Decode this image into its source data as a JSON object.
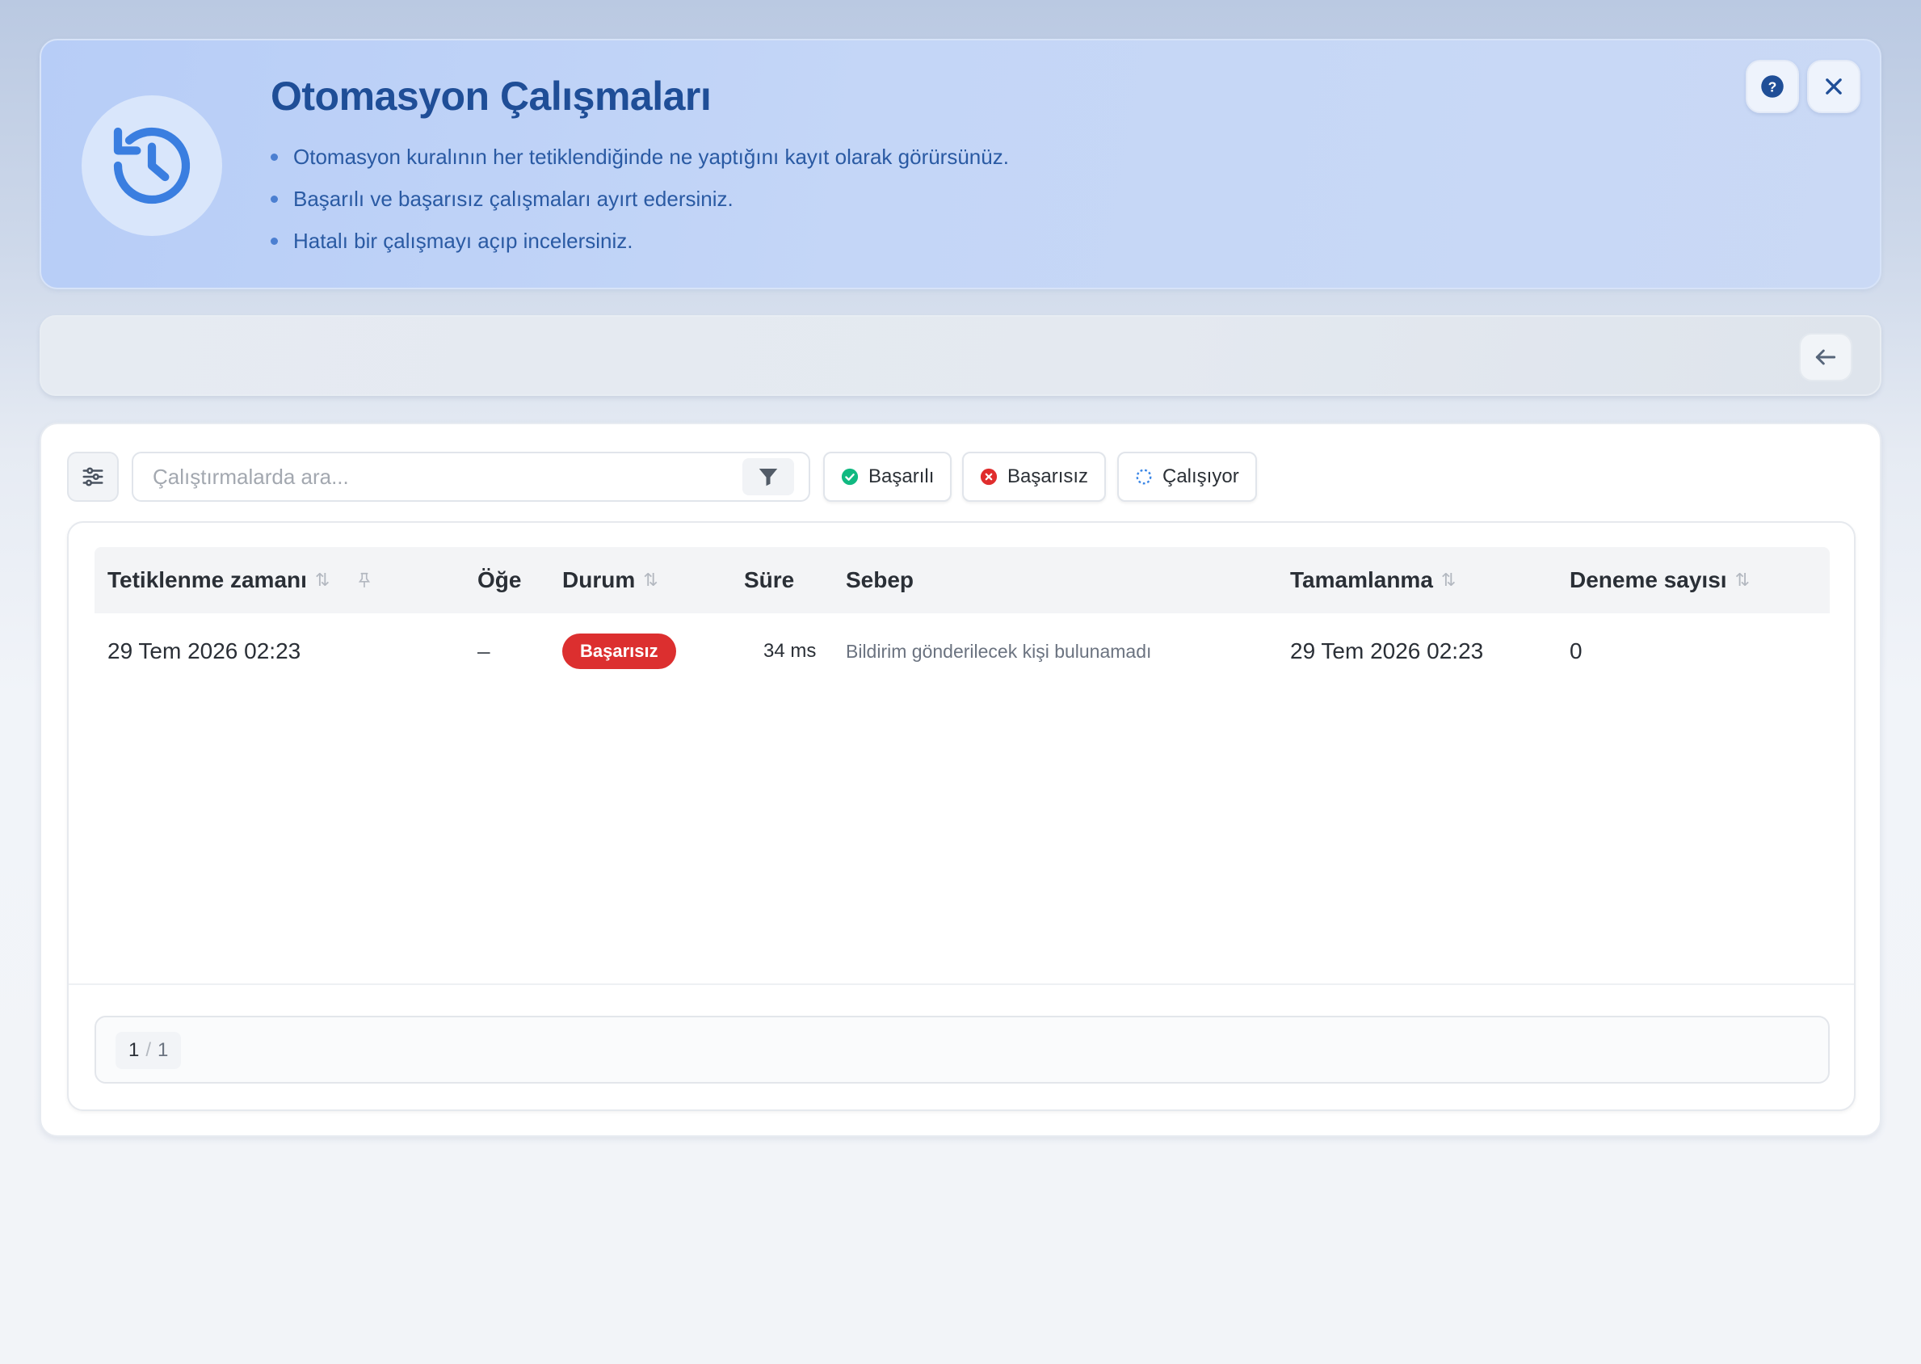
{
  "header": {
    "title": "Otomasyon Çalışmaları",
    "bullets": [
      "Otomasyon kuralının her tetiklendiğinde ne yaptığını kayıt olarak görürsünüz.",
      "Başarılı ve başarısız çalışmaları ayırt edersiniz.",
      "Hatalı bir çalışmayı açıp incelersiniz."
    ],
    "icon": "history-icon",
    "help_icon": "help-icon",
    "close_icon": "close-icon"
  },
  "strip": {
    "back_icon": "arrow-left-icon"
  },
  "toolbar": {
    "search_placeholder": "Çalıştırmalarda ara...",
    "chips": {
      "success": "Başarılı",
      "failed": "Başarısız",
      "running": "Çalışıyor"
    }
  },
  "table": {
    "columns": {
      "triggered": "Tetiklenme zamanı",
      "item": "Öğe",
      "status": "Durum",
      "duration": "Süre",
      "reason": "Sebep",
      "completed": "Tamamlanma",
      "attempts": "Deneme sayısı"
    },
    "rows": [
      {
        "triggered": "29 Tem 2026 02:23",
        "item": "–",
        "status": "Başarısız",
        "duration": "34 ms",
        "reason": "Bildirim gönderilecek kişi bulunamadı",
        "completed": "29 Tem 2026 02:23",
        "attempts": "0"
      }
    ]
  },
  "pagination": {
    "current": "1",
    "separator": "/",
    "total": "1"
  },
  "colors": {
    "title": "#1f4e97",
    "accent": "#3a7ee0",
    "danger": "#dc2f2f",
    "success": "#10b981"
  }
}
